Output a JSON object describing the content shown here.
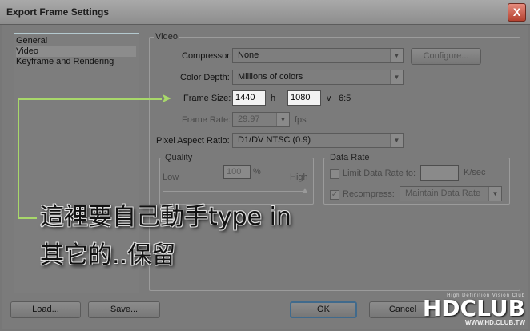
{
  "window": {
    "title": "Export Frame Settings",
    "close_glyph": "X"
  },
  "sidebar": {
    "items": [
      {
        "label": "General"
      },
      {
        "label": "Video"
      },
      {
        "label": "Keyframe and Rendering"
      }
    ]
  },
  "video": {
    "group_label": "Video",
    "compressor": {
      "label": "Compressor:",
      "value": "None"
    },
    "configure_label": "Configure...",
    "color_depth": {
      "label": "Color Depth:",
      "value": "Millions of colors"
    },
    "frame_size": {
      "label": "Frame Size:",
      "width": "1440",
      "width_unit": "h",
      "height": "1080",
      "height_unit": "v",
      "ratio": "6:5"
    },
    "frame_rate": {
      "label": "Frame Rate:",
      "value": "29.97",
      "unit": "fps"
    },
    "pixel_aspect": {
      "label": "Pixel Aspect Ratio:",
      "value": "D1/DV NTSC (0.9)"
    }
  },
  "quality": {
    "group_label": "Quality",
    "low": "Low",
    "high": "High",
    "value": "100",
    "unit": "%"
  },
  "data_rate": {
    "group_label": "Data Rate",
    "limit_label": "Limit Data Rate to:",
    "limit_unit": "K/sec",
    "recompress_label": "Recompress:",
    "recompress_value": "Maintain Data Rate"
  },
  "buttons": {
    "load": "Load...",
    "save": "Save...",
    "ok": "OK",
    "cancel": "Cancel"
  },
  "annotation": {
    "line1": "這裡要自己動手type in",
    "line2": "其它的..保留"
  },
  "logo": {
    "tagline": "High Definition Vision Club",
    "brand": "HDCLUB",
    "url": "WWW.HD.CLUB.TW"
  },
  "colors": {
    "annotation_arrow": "#a8d86a",
    "close_button": "#c05040"
  }
}
